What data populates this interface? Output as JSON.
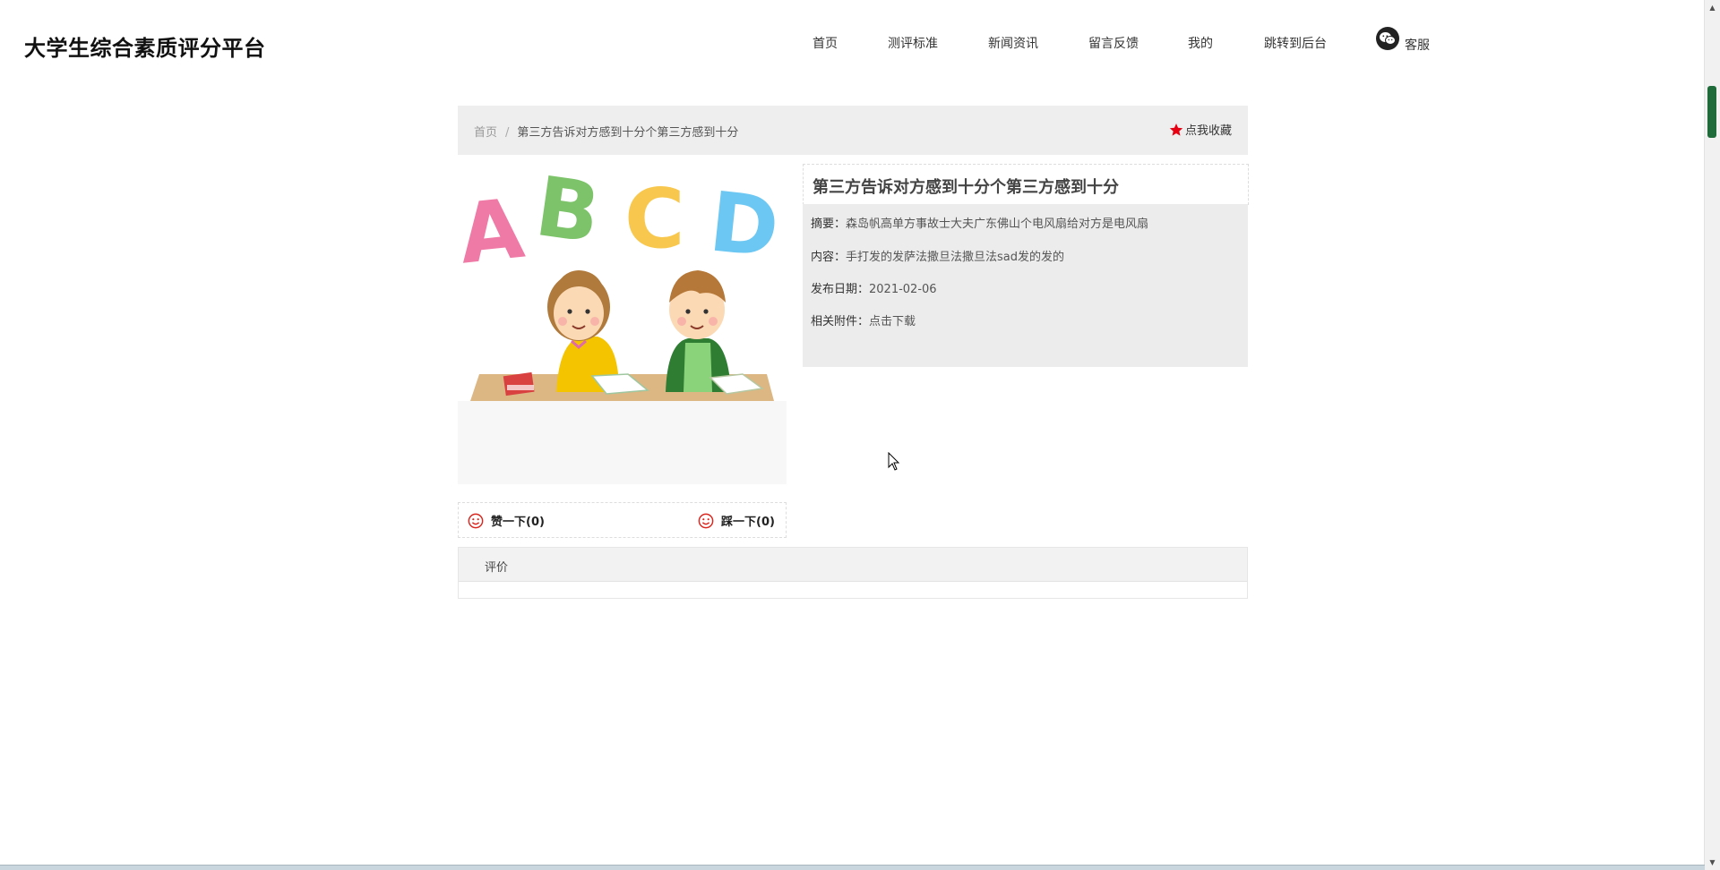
{
  "header": {
    "site_title": "大学生综合素质评分平台",
    "nav": [
      {
        "label": "首页"
      },
      {
        "label": "测评标准"
      },
      {
        "label": "新闻资讯"
      },
      {
        "label": "留言反馈"
      },
      {
        "label": "我的"
      },
      {
        "label": "跳转到后台"
      }
    ],
    "service_label": "客服",
    "service_icon": "wechat-icon"
  },
  "breadcrumb": {
    "home": "首页",
    "separator": "/",
    "current": "第三方告诉对方感到十分个第三方感到十分"
  },
  "favorite": {
    "label": "点我收藏",
    "icon": "star-icon",
    "icon_color": "#e60012"
  },
  "detail": {
    "title": "第三方告诉对方感到十分个第三方感到十分",
    "summary_label": "摘要：",
    "summary_value": "森岛帆高单方事故士大夫广东佛山个电风扇给对方是电风扇",
    "content_label": "内容：",
    "content_value": "手打发的发萨法撒旦法撒旦法sad发的发的",
    "date_label": "发布日期：",
    "date_value": "2021-02-06",
    "attachment_label": "相关附件：",
    "attachment_value": "点击下载"
  },
  "image": {
    "letters": [
      "A",
      "B",
      "C",
      "D"
    ],
    "letter_colors": [
      "#f07aa6",
      "#7cc36a",
      "#f8c84e",
      "#6cc7f2"
    ]
  },
  "votes": {
    "like_label": "赞一下(0)",
    "dislike_label": "踩一下(0)",
    "icon": "smiley-icon",
    "icon_color": "#d9251d"
  },
  "comments": {
    "header": "评价"
  }
}
